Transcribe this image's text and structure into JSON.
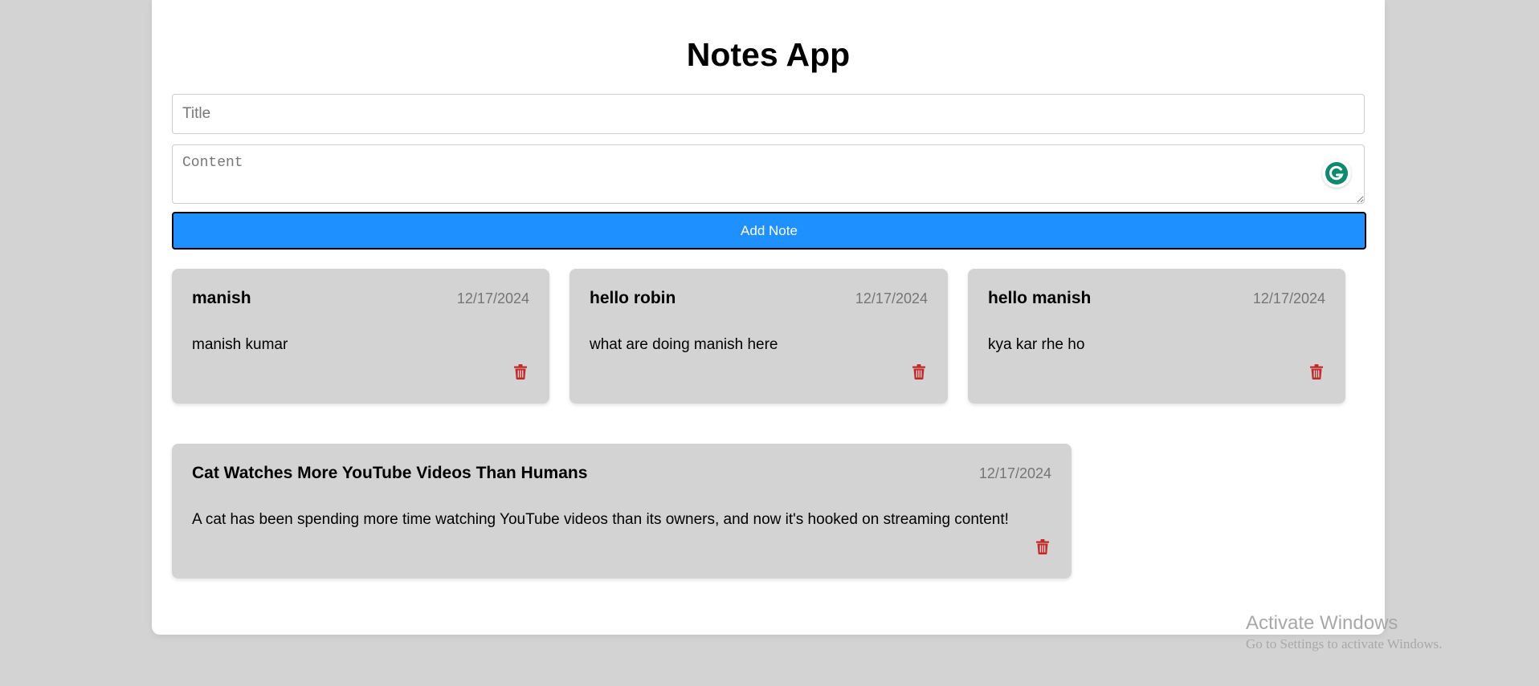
{
  "app": {
    "title": "Notes App"
  },
  "form": {
    "title_placeholder": "Title",
    "title_value": "",
    "content_placeholder": "Content",
    "content_value": "",
    "add_button_label": "Add Note"
  },
  "colors": {
    "accent": "#1e90ff",
    "card_background": "#d3d3d3",
    "delete_icon": "#c62828",
    "grammarly": "#15c39a"
  },
  "notes": [
    {
      "title": "manish",
      "date": "12/17/2024",
      "content": "manish kumar",
      "delete_icon": "trash-icon"
    },
    {
      "title": "hello robin",
      "date": "12/17/2024",
      "content": "what are doing manish here",
      "delete_icon": "trash-icon"
    },
    {
      "title": "hello manish",
      "date": "12/17/2024",
      "content": "kya kar rhe ho",
      "delete_icon": "trash-icon"
    },
    {
      "title": "Cat Watches More YouTube Videos Than Humans",
      "date": "12/17/2024",
      "content": "A cat has been spending more time watching YouTube videos than its owners, and now it's hooked on streaming content!",
      "delete_icon": "trash-icon"
    }
  ],
  "watermark": {
    "title": "Activate Windows",
    "subtitle": "Go to Settings to activate Windows."
  }
}
